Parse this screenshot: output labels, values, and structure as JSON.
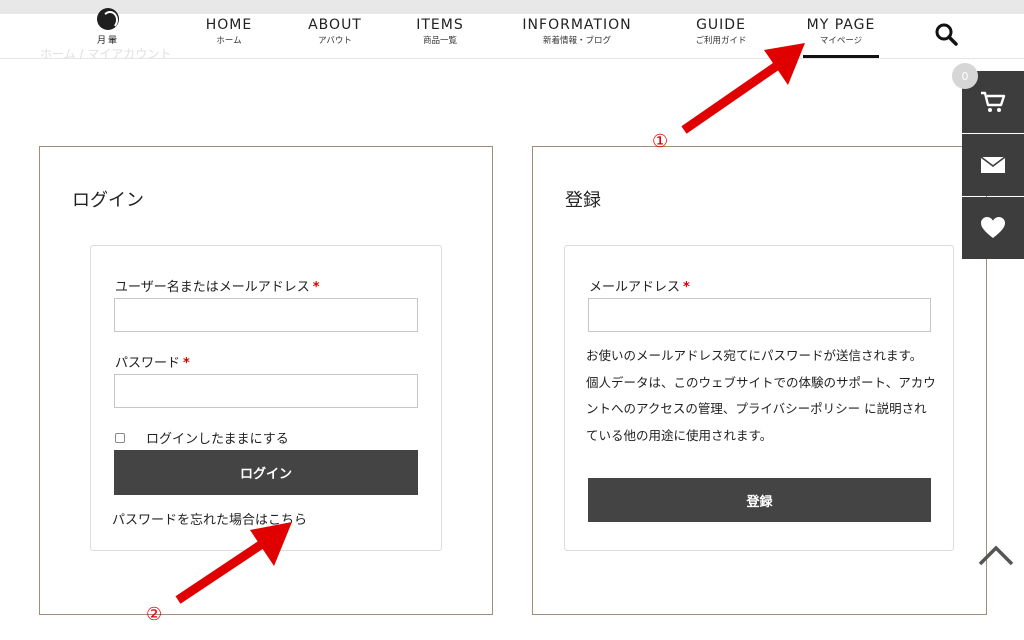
{
  "header": {
    "logo_text": "月暈",
    "nav": [
      {
        "en": "HOME",
        "ja": "ホーム"
      },
      {
        "en": "ABOUT",
        "ja": "アバウト"
      },
      {
        "en": "ITEMS",
        "ja": "商品一覧"
      },
      {
        "en": "INFORMATION",
        "ja": "新着情報・ブログ"
      },
      {
        "en": "GUIDE",
        "ja": "ご利用ガイド"
      },
      {
        "en": "MY PAGE",
        "ja": "マイページ"
      }
    ],
    "active_nav": "MY PAGE",
    "search_icon": "search-icon"
  },
  "breadcrumb": "ホーム / マイアカウント",
  "login": {
    "title": "ログイン",
    "username_label": "ユーザー名またはメールアドレス",
    "password_label": "パスワード",
    "required_mark": "*",
    "username_value": "",
    "password_value": "",
    "remember_label": "ログインしたままにする",
    "remember_checked": false,
    "submit_label": "ログイン",
    "forgot_link": "パスワードを忘れた場合はこちら"
  },
  "register": {
    "title": "登録",
    "email_label": "メールアドレス",
    "email_value": "",
    "notice_line1": "お使いのメールアドレス宛てにパスワードが送信されます。",
    "notice_line2": "個人データは、このウェブサイトでの体験のサポート、アカウントへのアクセスの管理、プライバシーポリシー に説明されている他の用途に使用されます。",
    "submit_label": "登録"
  },
  "side_tools": {
    "cart_count": "0",
    "cart_icon": "cart-icon",
    "mail_icon": "mail-icon",
    "heart_icon": "heart-icon"
  },
  "scroll_top_icon": "chevron-up-icon",
  "annotations": {
    "marker1": "①",
    "marker2": "②"
  },
  "colors": {
    "arrow": "#e00000",
    "button_dark": "#444444",
    "panel_border": "#a08e7b",
    "side_tool_bg": "#3d3d3d",
    "required": "#d40000"
  }
}
